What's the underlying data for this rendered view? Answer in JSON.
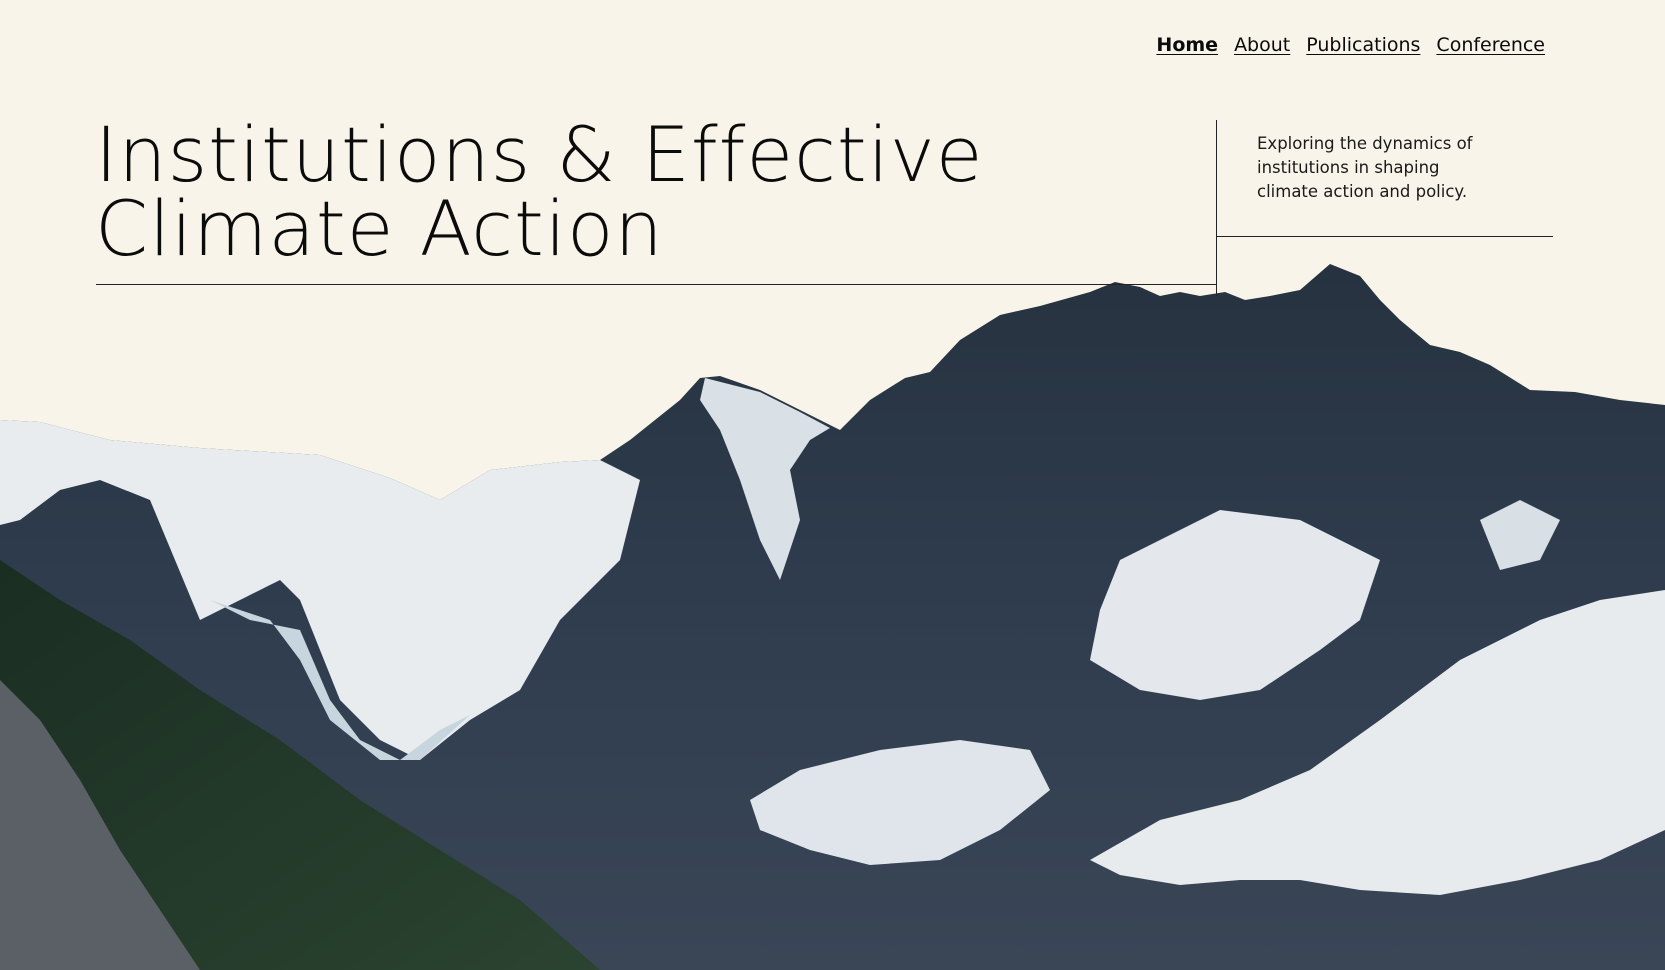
{
  "nav": {
    "items": [
      {
        "label": "Home",
        "active": true
      },
      {
        "label": "About",
        "active": false
      },
      {
        "label": "Publications",
        "active": false
      },
      {
        "label": "Conference",
        "active": false
      }
    ]
  },
  "hero": {
    "title_line1": "Institutions & Effective",
    "title_line2": "Climate Action",
    "tagline": "Exploring the dynamics of institutions in shaping climate action and policy."
  },
  "colors": {
    "background": "#f8f4e9",
    "text": "#0b0b0b",
    "rule": "#222222",
    "rock": "#2c3a4c",
    "snow": "#e8ecef",
    "forest": "#1f3526"
  },
  "image": {
    "icon": "mountain-glacier-photo"
  }
}
